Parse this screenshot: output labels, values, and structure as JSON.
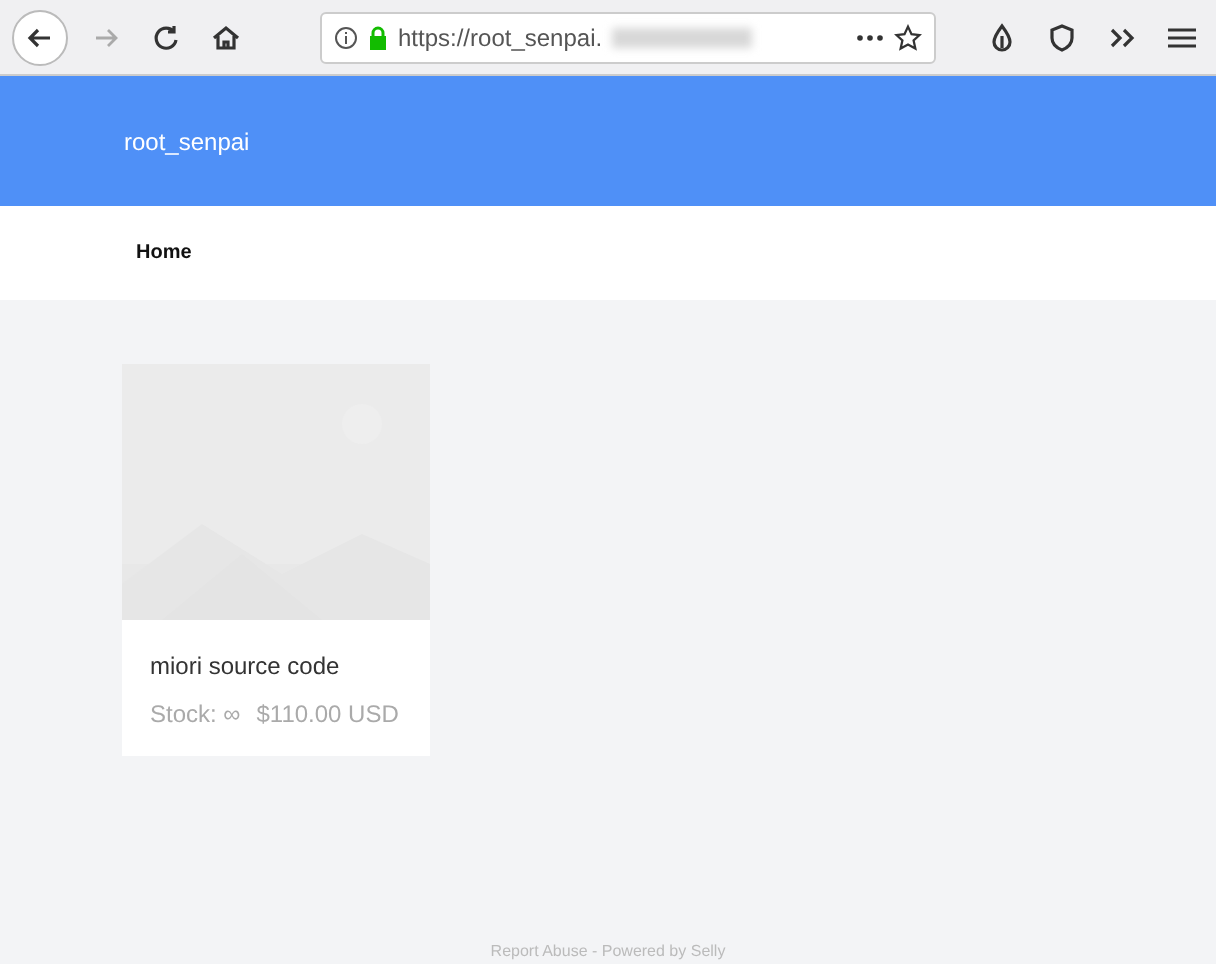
{
  "browser": {
    "url": "https://root_senpai."
  },
  "header": {
    "title": "root_senpai"
  },
  "nav": {
    "items": [
      {
        "label": "Home"
      }
    ]
  },
  "products": [
    {
      "name": "miori source code",
      "stock": "Stock: ∞",
      "price": "$110.00 USD"
    }
  ],
  "footer": {
    "text": "Report Abuse - Powered by Selly"
  }
}
